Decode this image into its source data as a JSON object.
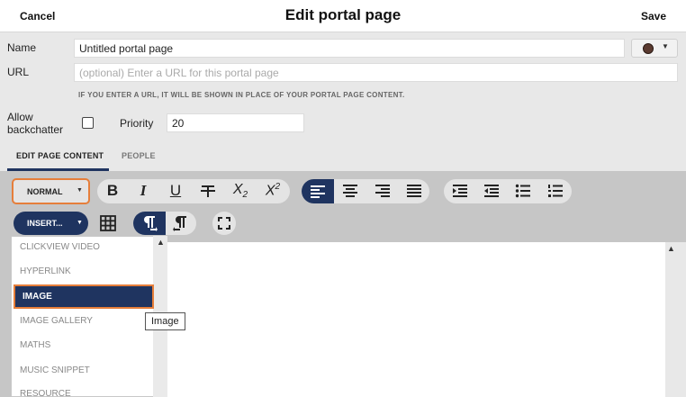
{
  "header": {
    "cancel": "Cancel",
    "title": "Edit portal page",
    "save": "Save"
  },
  "form": {
    "name_label": "Name",
    "name_value": "Untitled portal page",
    "url_label": "URL",
    "url_placeholder": "(optional) Enter a URL for this portal page",
    "url_hint": "IF YOU ENTER A URL, IT WILL BE SHOWN IN PLACE OF YOUR PORTAL PAGE CONTENT.",
    "allow_label_line1": "Allow",
    "allow_label_line2": "backchatter",
    "priority_label": "Priority",
    "priority_value": "20",
    "color": "#5a3a30"
  },
  "tabs": [
    {
      "label": "EDIT PAGE CONTENT",
      "active": true
    },
    {
      "label": "PEOPLE",
      "active": false
    }
  ],
  "toolbar": {
    "style_select": "NORMAL",
    "insert": "INSERT...",
    "icons": [
      "bold-icon",
      "italic-icon",
      "underline-icon",
      "strikethrough-icon",
      "subscript-icon",
      "superscript-icon",
      "align-left-icon",
      "align-center-icon",
      "align-right-icon",
      "align-justify-icon",
      "indent-icon",
      "outdent-icon",
      "bullet-list-icon",
      "numbered-list-icon",
      "table-icon",
      "ltr-icon",
      "rtl-icon",
      "fullscreen-icon"
    ],
    "bold": "B",
    "italic": "I",
    "underline": "U",
    "sub": "X",
    "sub_suffix": "2",
    "sup": "X",
    "sup_suffix": "2",
    "accent": "#1f3460",
    "highlight": "#e67e3a"
  },
  "insert_menu": {
    "items": [
      "CLICKVIEW VIDEO",
      "HYPERLINK",
      "IMAGE",
      "IMAGE GALLERY",
      "MATHS",
      "MUSIC SNIPPET",
      "RESOURCE"
    ],
    "selected": "IMAGE",
    "tooltip": "Image"
  }
}
